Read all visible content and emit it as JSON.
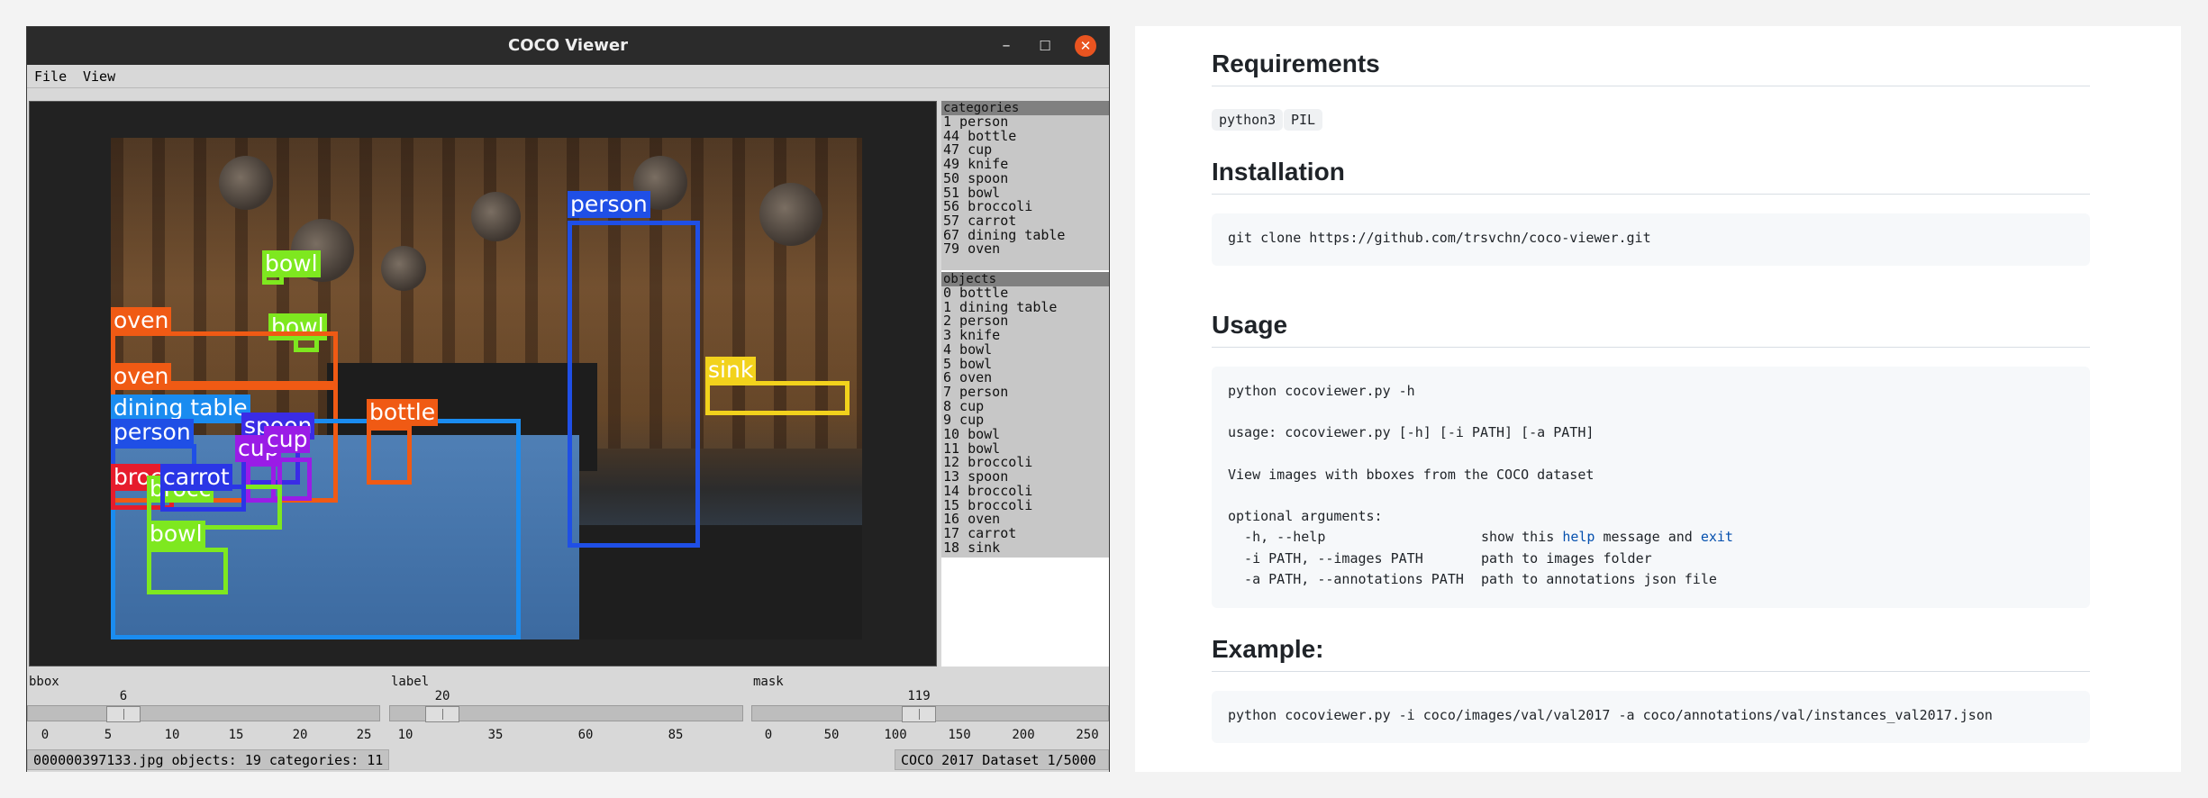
{
  "window": {
    "title": "COCO Viewer",
    "controls": {
      "minimize": "–",
      "maximize": "☐",
      "close": "✕"
    }
  },
  "menu": [
    "File",
    "View"
  ],
  "detections": [
    {
      "label": "person",
      "color": "#1f4fe6"
    },
    {
      "label": "bowl",
      "color": "#7ee81f"
    },
    {
      "label": "bowl",
      "color": "#7ee81f"
    },
    {
      "label": "oven",
      "color": "#f05a14"
    },
    {
      "label": "oven",
      "color": "#f05a14"
    },
    {
      "label": "sink",
      "color": "#f2d21c"
    },
    {
      "label": "dining table",
      "color": "#1a8cf0"
    },
    {
      "label": "bottle",
      "color": "#f05a14"
    },
    {
      "label": "person",
      "color": "#1f4fe6"
    },
    {
      "label": "spoon",
      "color": "#3a2ce6"
    },
    {
      "label": "cup",
      "color": "#9a1ce6"
    },
    {
      "label": "cup",
      "color": "#9a1ce6"
    },
    {
      "label": "brocc",
      "color": "#e61c2c"
    },
    {
      "label": "brocc",
      "color": "#7ee81f"
    },
    {
      "label": "carrot",
      "color": "#2a36e6"
    },
    {
      "label": "bowl",
      "color": "#7ee81f"
    }
  ],
  "categories": {
    "header": "categories",
    "items": [
      "1 person",
      "44 bottle",
      "47 cup",
      "49 knife",
      "50 spoon",
      "51 bowl",
      "56 broccoli",
      "57 carrot",
      "67 dining table",
      "79 oven"
    ]
  },
  "objects": {
    "header": "objects",
    "items": [
      "0 bottle",
      "1 dining table",
      "2 person",
      "3 knife",
      "4 bowl",
      "5 bowl",
      "6 oven",
      "7 person",
      "8 cup",
      "9 cup",
      "10 bowl",
      "11 bowl",
      "12 broccoli",
      "13 spoon",
      "14 broccoli",
      "15 broccoli",
      "16 oven",
      "17 carrot",
      "18 sink"
    ]
  },
  "sliders": [
    {
      "name": "bbox",
      "value": "6",
      "ticks": [
        "0",
        "5",
        "10",
        "15",
        "20",
        "25"
      ]
    },
    {
      "name": "label",
      "value": "20",
      "ticks": [
        "10",
        "35",
        "60",
        "85"
      ]
    },
    {
      "name": "mask",
      "value": "119",
      "ticks": [
        "0",
        "50",
        "100",
        "150",
        "200",
        "250"
      ]
    }
  ],
  "status": {
    "left": "000000397133.jpg objects: 19 categories: 11",
    "right": "COCO 2017 Dataset  1/5000"
  },
  "readme": {
    "requirements_title": "Requirements",
    "requirements": [
      "python3",
      "PIL"
    ],
    "installation_title": "Installation",
    "install_cmd": "git clone https://github.com/trsvchn/coco-viewer.git",
    "usage_title": "Usage",
    "usage_lines": [
      "python cocoviewer.py -h",
      "",
      "usage: cocoviewer.py [-h] [-i PATH] [-a PATH]",
      "",
      "View images with bboxes from the COCO dataset",
      "",
      "optional arguments:"
    ],
    "usage_args": [
      {
        "flag": "  -h, --help",
        "desc_pre": "show this ",
        "desc_kw1": "help",
        "desc_mid": " message and ",
        "desc_kw2": "exit"
      },
      {
        "flag": "  -i PATH, --images PATH",
        "desc": "path to images folder"
      },
      {
        "flag": "  -a PATH, --annotations PATH",
        "desc": "path to annotations json file"
      }
    ],
    "example_title": "Example:",
    "example_cmd": "python cocoviewer.py -i coco/images/val/val2017 -a coco/annotations/val/instances_val2017.json"
  }
}
